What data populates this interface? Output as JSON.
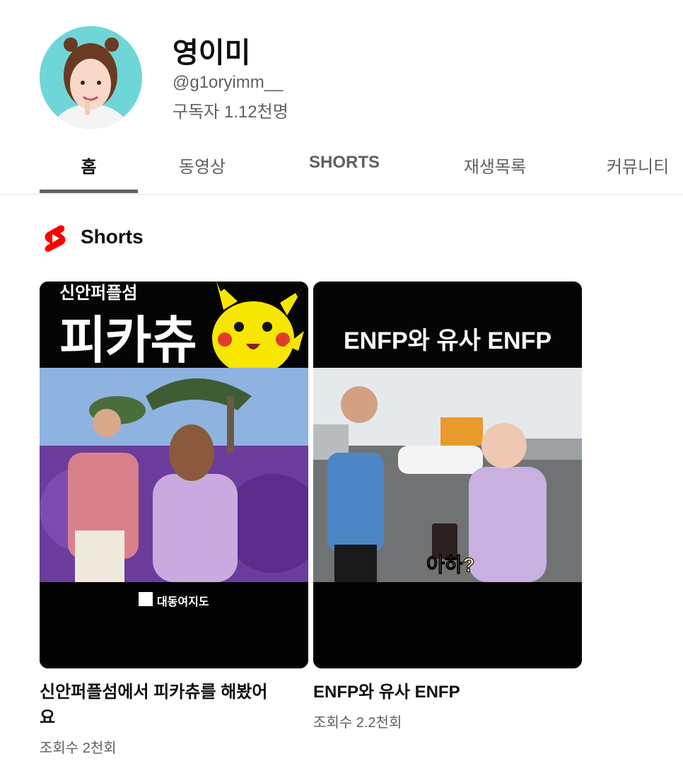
{
  "channel": {
    "name": "영이미",
    "handle": "@g1oryimm__",
    "subscribers": "구독자 1.12천명"
  },
  "tabs": [
    {
      "label": "홈",
      "active": true
    },
    {
      "label": "동영상",
      "active": false
    },
    {
      "label": "SHORTS",
      "active": false
    },
    {
      "label": "재생목록",
      "active": false
    },
    {
      "label": "커뮤니티",
      "active": false
    }
  ],
  "shorts_section": {
    "icon": "youtube-shorts-icon",
    "title": "Shorts",
    "accent_color": "#ff0000"
  },
  "shorts": [
    {
      "thumb_top_small": "신안퍼플섬",
      "thumb_top_big": "피카츄",
      "thumb_logo": "대동여지도",
      "title": "신안퍼플섬에서 피카츄를 해봤어요",
      "views": "조회수 2천회"
    },
    {
      "thumb_top_big": "ENFP와 유사 ENFP",
      "thumb_caption": "아하?",
      "title": "ENFP와 유사 ENFP",
      "views": "조회수 2.2천회"
    }
  ]
}
